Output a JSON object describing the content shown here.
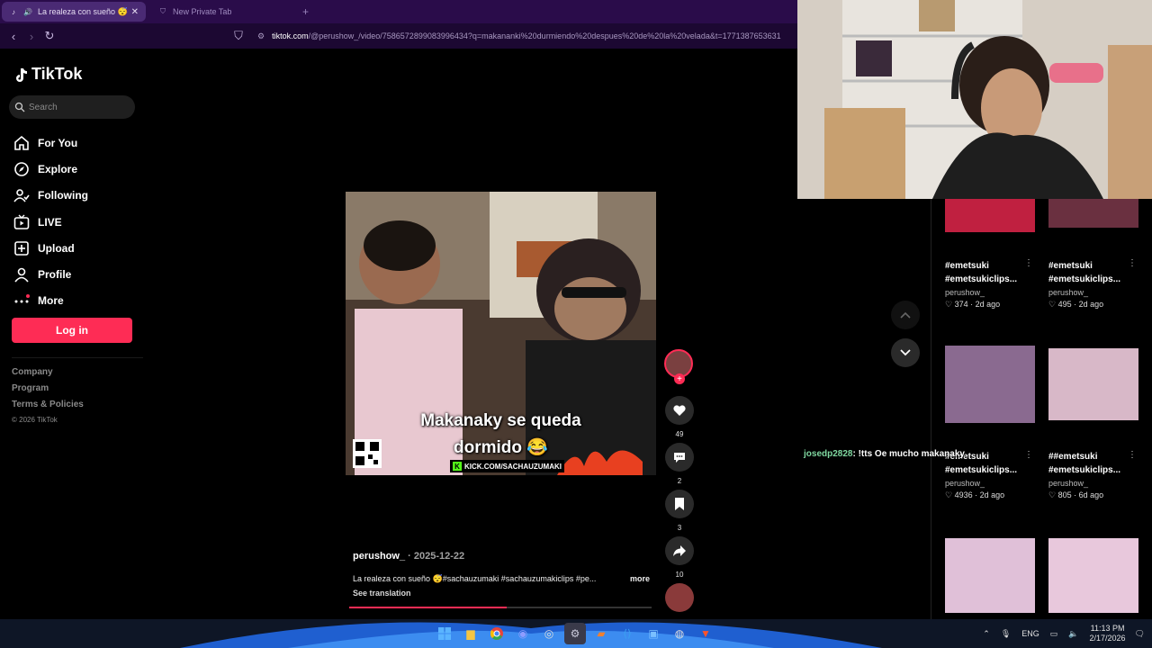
{
  "browser": {
    "tabs": [
      {
        "label": "La realeza con sueño 😴#sac",
        "active": true
      },
      {
        "label": "New Private Tab",
        "active": false
      }
    ],
    "url_host": "tiktok.com",
    "url_path": "/@perushow_/video/7586572899083996434?q=makananki%20durmiendo%20despues%20de%20la%20velada&t=1771387653631"
  },
  "sidebar": {
    "brand": "TikTok",
    "search_placeholder": "Search",
    "items": [
      {
        "label": "For You",
        "icon": "home-icon"
      },
      {
        "label": "Explore",
        "icon": "compass-icon"
      },
      {
        "label": "Following",
        "icon": "following-icon"
      },
      {
        "label": "LIVE",
        "icon": "live-icon"
      },
      {
        "label": "Upload",
        "icon": "upload-icon"
      },
      {
        "label": "Profile",
        "icon": "profile-icon"
      },
      {
        "label": "More",
        "icon": "more-icon"
      }
    ],
    "login_label": "Log in",
    "footer": [
      "Company",
      "Program",
      "Terms & Policies"
    ],
    "copyright": "© 2026 TikTok"
  },
  "video": {
    "overlay_line1": "Makanaky se queda",
    "overlay_line2": "dormido 😂",
    "kick_label": "KICK.COM/SACHAUZUMAKI",
    "author": "perushow_",
    "date": "· 2025-12-22",
    "description": "La realeza con sueño 😴#sachauzumaki #sachauzumakiclips #pe...",
    "more_label": "more",
    "translation_label": "See translation",
    "progress": 0.52
  },
  "actions": {
    "likes": "49",
    "comments": "2",
    "saves": "3",
    "shares": "10"
  },
  "related": [
    {
      "tag": "#emetsuki",
      "tag2": "#emetsukiclips...",
      "user": "perushow_",
      "likes": "374",
      "age": "2d ago"
    },
    {
      "tag": "#emetsuki",
      "tag2": "#emetsukiclips...",
      "user": "perushow_",
      "likes": "495",
      "age": "2d ago"
    },
    {
      "tag": "#emetsuki",
      "tag2": "#emetsukiclips...",
      "user": "perushow_",
      "likes": "4936",
      "age": "2d ago"
    },
    {
      "tag": "##emetsuki",
      "tag2": "#emetsukiclips...",
      "user": "perushow_",
      "likes": "805",
      "age": "6d ago"
    }
  ],
  "chat": {
    "name": "josedp2828",
    "message": ": !tts Oe mucho makanaky"
  },
  "taskbar": {
    "language": "ENG",
    "time": "11:13 PM",
    "date": "2/17/2026"
  },
  "colors": {
    "accent": "#fe2c55",
    "tab_bar": "#2a0c4a"
  }
}
